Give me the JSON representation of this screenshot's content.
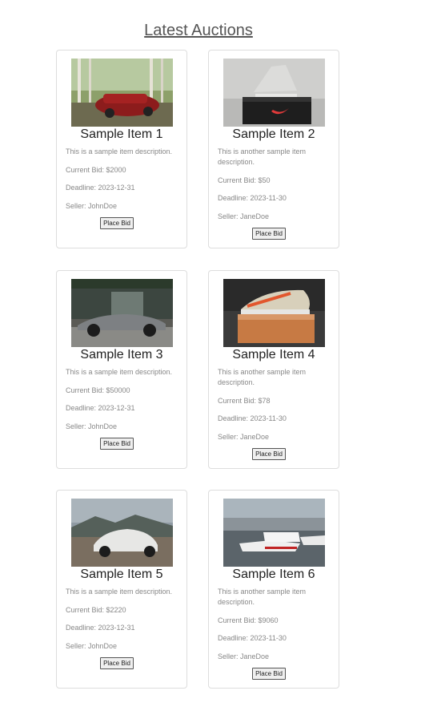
{
  "header": {
    "title": "Latest Auctions"
  },
  "items": [
    {
      "title": "Sample Item 1",
      "description": "This is a sample item description.",
      "bid": "Current Bid: $2000",
      "deadline": "Deadline: 2023-12-31",
      "seller": "Seller: JohnDoe",
      "button": "Place Bid"
    },
    {
      "title": "Sample Item 2",
      "description": "This is another sample item description.",
      "bid": "Current Bid: $50",
      "deadline": "Deadline: 2023-11-30",
      "seller": "Seller: JaneDoe",
      "button": "Place Bid"
    },
    {
      "title": "Sample Item 3",
      "description": "This is a sample item description.",
      "bid": "Current Bid: $50000",
      "deadline": "Deadline: 2023-12-31",
      "seller": "Seller: JohnDoe",
      "button": "Place Bid"
    },
    {
      "title": "Sample Item 4",
      "description": "This is another sample item description.",
      "bid": "Current Bid: $78",
      "deadline": "Deadline: 2023-11-30",
      "seller": "Seller: JaneDoe",
      "button": "Place Bid"
    },
    {
      "title": "Sample Item 5",
      "description": "This is a sample item description.",
      "bid": "Current Bid: $2220",
      "deadline": "Deadline: 2023-12-31",
      "seller": "Seller: JohnDoe",
      "button": "Place Bid"
    },
    {
      "title": "Sample Item 6",
      "description": "This is another sample item description.",
      "bid": "Current Bid: $9060",
      "deadline": "Deadline: 2023-11-30",
      "seller": "Seller: JaneDoe",
      "button": "Place Bid"
    }
  ]
}
